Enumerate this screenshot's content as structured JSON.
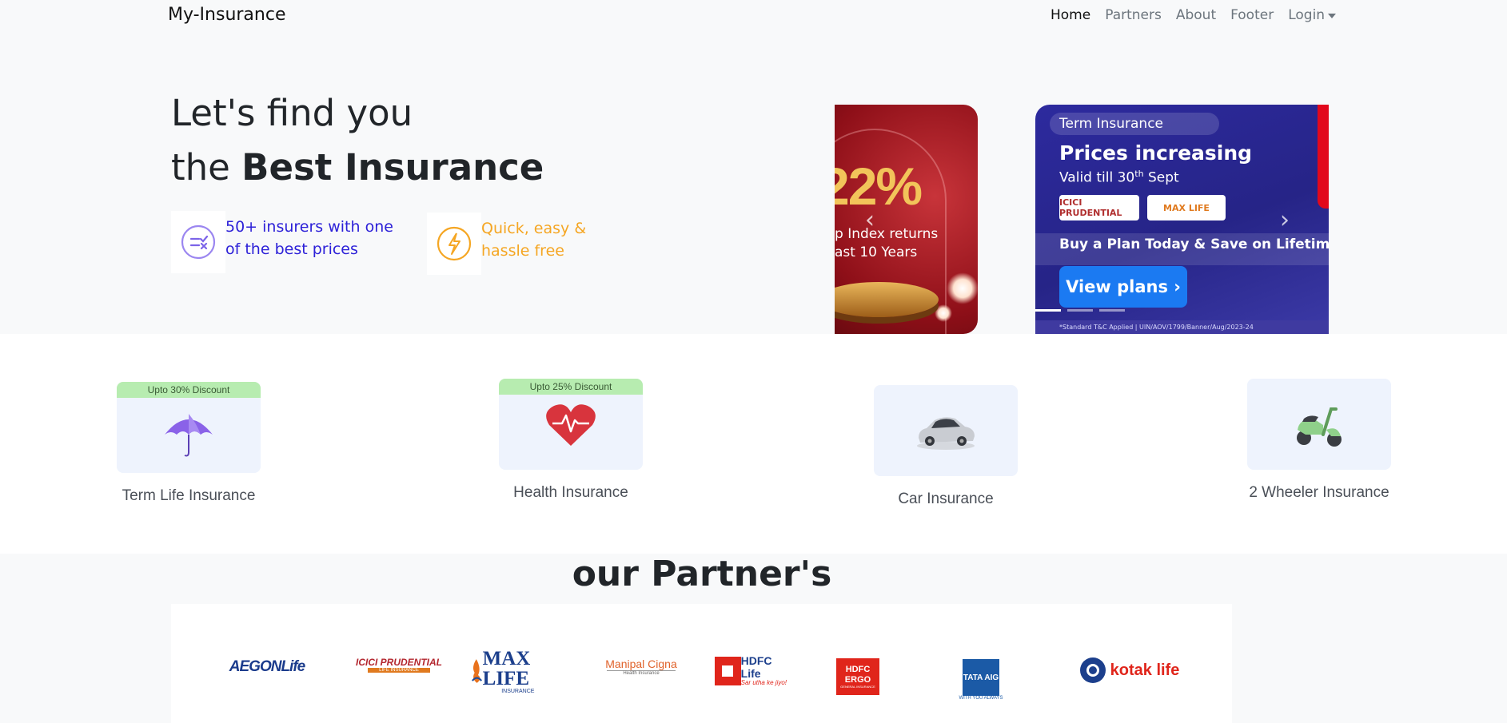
{
  "nav": {
    "brand": "My-Insurance",
    "links": [
      "Home",
      "Partners",
      "About",
      "Footer"
    ],
    "login": "Login"
  },
  "hero": {
    "title_line1": "Let's find you",
    "title_line2_prefix": "the ",
    "title_line2_bold": "Best Insurance",
    "features": [
      {
        "line1": "50+ insurers with one",
        "line2": "of the best prices",
        "icon": "compare-icon",
        "color": "#2d21d8"
      },
      {
        "line1": "Quick, easy &",
        "line2": "hassle free",
        "icon": "lightning-icon",
        "color": "#f5a623"
      }
    ]
  },
  "carousel": {
    "slide1": {
      "percent": "22%",
      "line1": "p Index returns",
      "line2": "ast 10 Years"
    },
    "slide2": {
      "tag": "Term Insurance",
      "headline": "Prices increasing",
      "subline_prefix": "Valid till 30",
      "subline_sup": "th",
      "subline_suffix": " Sept",
      "logo1": "ICICI PRUDENTIAL",
      "logo2": "MAX LIFE",
      "buy": "Buy a Plan Today & Save on Lifetime Pren",
      "button": "View plans ›",
      "footnote": "*Standard T&C Applied  |  UIN/AOV/1799/Banner/Aug/2023-24"
    },
    "prev": "‹",
    "next": "›"
  },
  "categories": [
    {
      "label": "Term Life Insurance",
      "discount": "Upto 30% Discount",
      "icon": "umbrella-icon"
    },
    {
      "label": "Health Insurance",
      "discount": "Upto 25% Discount",
      "icon": "heart-icon"
    },
    {
      "label": "Car Insurance",
      "discount": "",
      "icon": "car-icon"
    },
    {
      "label": "2 Wheeler Insurance",
      "discount": "",
      "icon": "scooter-icon"
    }
  ],
  "partners": {
    "title": "our Partner's",
    "logos": [
      "AEGONLife",
      "ICICI PRUDENTIAL",
      "MAX LIFE",
      "Manipal Cigna",
      "HDFC Life",
      "HDFC ERGO",
      "TATA AIG",
      "kotak life"
    ],
    "maxlife_sub": "INSURANCE",
    "manipal_sub": "Health Insurance",
    "hdfclife_tag": "Sar utha ke jiyo!",
    "hdfcergo_sub": "GENERAL INSURANCE",
    "tata_sub": "WITH YOU ALWAYS",
    "icici_sub": "LIFE INSURANCE"
  }
}
